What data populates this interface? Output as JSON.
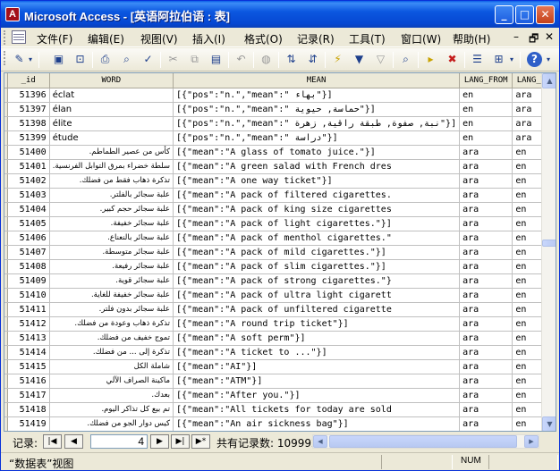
{
  "window": {
    "app_name": "Microsoft Access",
    "doc_title": "[英语阿拉伯语 : 表]",
    "min_label": "_",
    "max_label": "□",
    "close_label": "✕"
  },
  "menu": [
    {
      "label": "文件(F)"
    },
    {
      "label": "编辑(E)"
    },
    {
      "label": "视图(V)"
    },
    {
      "label": "插入(I)"
    },
    {
      "label": "格式(O)"
    },
    {
      "label": "记录(R)"
    },
    {
      "label": "工具(T)"
    },
    {
      "label": "窗口(W)"
    },
    {
      "label": "帮助(H)"
    }
  ],
  "mdi_controls": {
    "minimize": "–",
    "restore": "🗗",
    "close": "✕"
  },
  "toolbar_icons": [
    "design-view-icon",
    "save-icon",
    "file-search-icon",
    "print-icon",
    "print-preview-icon",
    "spelling-icon",
    "cut-icon",
    "copy-icon",
    "paste-icon",
    "undo-icon",
    "hyperlink-icon",
    "sort-ascending-icon",
    "sort-descending-icon",
    "filter-by-selection-icon",
    "filter-by-form-icon",
    "apply-filter-icon",
    "find-icon",
    "new-record-icon",
    "delete-record-icon",
    "properties-icon",
    "new-object-icon",
    "help-icon"
  ],
  "table": {
    "columns": [
      "_id",
      "WORD",
      "MEAN",
      "LANG_FROM",
      "LANG_TO"
    ],
    "rows": [
      {
        "id": "51396",
        "word": "éclat",
        "ar": false,
        "mean": "[{\"pos\":\"n.\",\"mean\":\" بهاء\"}]",
        "from": "en",
        "to": "ara"
      },
      {
        "id": "51397",
        "word": "élan",
        "ar": false,
        "mean": "[{\"pos\":\"n.\",\"mean\":\" حماسة, حيوية\"}]",
        "from": "en",
        "to": "ara"
      },
      {
        "id": "51398",
        "word": "élite",
        "ar": false,
        "mean": "[{\"pos\":\"n.\",\"mean\":\" نبة, صفوة, طبقة راقية, زهرة\"}]",
        "from": "en",
        "to": "ara"
      },
      {
        "id": "51399",
        "word": "étude",
        "ar": false,
        "mean": "[{\"pos\":\"n.\",\"mean\":\" دراسة\"}]",
        "from": "en",
        "to": "ara"
      },
      {
        "id": "51400",
        "word": "كأس من عصير الطماطم.",
        "ar": true,
        "mean": "[{\"mean\":\"A glass of tomato juice.\"}]",
        "from": "ara",
        "to": "en"
      },
      {
        "id": "51401",
        "word": "سلطة خضراء بمرق التوابل الفرنسية.",
        "ar": true,
        "mean": "[{\"mean\":\"A green salad with French dres",
        "from": "ara",
        "to": "en"
      },
      {
        "id": "51402",
        "word": "تذكرة ذهاب فقط من فضلك.",
        "ar": true,
        "mean": "[{\"mean\":\"A one way ticket\"}]",
        "from": "ara",
        "to": "en"
      },
      {
        "id": "51403",
        "word": "علبة سجائر بالفلتر.",
        "ar": true,
        "mean": "[{\"mean\":\"A pack of filtered cigarettes.",
        "from": "ara",
        "to": "en"
      },
      {
        "id": "51404",
        "word": "علبة سجائر حجم كبير.",
        "ar": true,
        "mean": "[{\"mean\":\"A pack of king size cigarettes",
        "from": "ara",
        "to": "en"
      },
      {
        "id": "51405",
        "word": "علبة سجائر خفيفة.",
        "ar": true,
        "mean": "[{\"mean\":\"A pack of light cigarettes.\"}]",
        "from": "ara",
        "to": "en"
      },
      {
        "id": "51406",
        "word": "علبة سجائر بالنعناع.",
        "ar": true,
        "mean": "[{\"mean\":\"A pack of menthol cigarettes.\"",
        "from": "ara",
        "to": "en"
      },
      {
        "id": "51407",
        "word": "علبة سجائر متوسطة.",
        "ar": true,
        "mean": "[{\"mean\":\"A pack of mild cigarettes.\"}]",
        "from": "ara",
        "to": "en"
      },
      {
        "id": "51408",
        "word": "علبة سجائر رفيعة.",
        "ar": true,
        "mean": "[{\"mean\":\"A pack of slim cigarettes.\"}]",
        "from": "ara",
        "to": "en"
      },
      {
        "id": "51409",
        "word": "علبة سجائر قوية.",
        "ar": true,
        "mean": "[{\"mean\":\"A pack of strong cigarettes.\"}",
        "from": "ara",
        "to": "en"
      },
      {
        "id": "51410",
        "word": "علبة سجائر خفيفة للغاية.",
        "ar": true,
        "mean": "[{\"mean\":\"A pack of ultra light cigarett",
        "from": "ara",
        "to": "en"
      },
      {
        "id": "51411",
        "word": "علبة سجائر بدون فلتر.",
        "ar": true,
        "mean": "[{\"mean\":\"A pack of unfiltered cigarette",
        "from": "ara",
        "to": "en"
      },
      {
        "id": "51412",
        "word": "تذكرة ذهاب وعودة من فضلك.",
        "ar": true,
        "mean": "[{\"mean\":\"A round trip ticket\"}]",
        "from": "ara",
        "to": "en"
      },
      {
        "id": "51413",
        "word": "تموج خفيف من فضلك.",
        "ar": true,
        "mean": "[{\"mean\":\"A soft perm\"}]",
        "from": "ara",
        "to": "en"
      },
      {
        "id": "51414",
        "word": "تذكرة إلى ... من فضلك.",
        "ar": true,
        "mean": "[{\"mean\":\"A ticket to ...\"}]",
        "from": "ara",
        "to": "en"
      },
      {
        "id": "51415",
        "word": "شاملة الكل",
        "ar": true,
        "mean": "[{\"mean\":\"AI\"}]",
        "from": "ara",
        "to": "en"
      },
      {
        "id": "51416",
        "word": "ماكينة الصراف الآلي",
        "ar": true,
        "mean": "[{\"mean\":\"ATM\"}]",
        "from": "ara",
        "to": "en"
      },
      {
        "id": "51417",
        "word": "بعدك.",
        "ar": true,
        "mean": "[{\"mean\":\"After you.\"}]",
        "from": "ara",
        "to": "en"
      },
      {
        "id": "51418",
        "word": "تم بيع كل تذاكر اليوم.",
        "ar": true,
        "mean": "[{\"mean\":\"All tickets for today are sold",
        "from": "ara",
        "to": "en"
      },
      {
        "id": "51419",
        "word": "كيس دوار الجو من فضلك.",
        "ar": true,
        "mean": "[{\"mean\":\"An air sickness bag\"}]",
        "from": "ara",
        "to": "en"
      }
    ]
  },
  "navigator": {
    "label": "记录:",
    "current_record": "4",
    "first": "|◀",
    "prev": "◀",
    "next": "▶",
    "last": "▶|",
    "new": "▶*",
    "total_text": "共有记录数: 109992"
  },
  "status": {
    "view_text": "“数据表”视图",
    "num_indicator": "NUM"
  },
  "colors": {
    "title_blue": "#0b57e0",
    "window_face": "#ece9d8",
    "grid_line": "#c0c0c0"
  }
}
